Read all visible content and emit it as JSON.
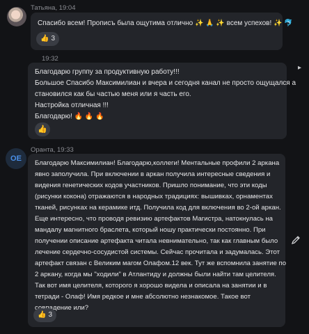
{
  "messages": [
    {
      "author": "Татьяна",
      "time": "19:04",
      "lines": [
        "Спасибо всем! Прописъ была ощутима отлично ✨ 🙏 ✨ всем успехов! ✨ 🐬"
      ],
      "reaction": {
        "emoji": "👍",
        "count": "3"
      }
    },
    {
      "author": "",
      "time": "19:32",
      "lines": [
        "Благодарю группу за продуктивную работу!!!",
        "Большое Спасибо Максимилиан и вчера и сегодня канал не просто ощущался а",
        "становился как бы частью меня или я часть его.",
        "Настройка отличная !!!",
        "Благодарю! 🔥 🔥 🔥"
      ],
      "reaction": {
        "emoji": "👍",
        "count": ""
      }
    },
    {
      "author": "Оранта",
      "time": "19:33",
      "avatar_initials": "OE",
      "lines": [
        "Благодарю Максимилиан! Благодарю,коллеги! Ментальные профили 2 аркана",
        "явно заполучила. При включении в аркан получила интересные сведения и",
        "видения генетических кодов участников. Пришло понимание, что эти коды",
        "(рисунки кокона) отражаются в народных традициях:  вышивках, орнаментах",
        "тканей, рисунках на керамике итд. Получила код для включения во 2-ой аркан.",
        "Еще интересно, что проводя ревизию артефактов Магистра, натокнулась на",
        "мандалу магнитного браслета, который ношу практически постоянно. При",
        "получении описание артефакта читала невнимательно, так как главным было",
        "лечение сердечно-сосудистой системы. Сейчас прочитала и задумалась. Этот",
        "артефакт связан с Великим магом Олафом.12 век.  Тут же вспомнила занятие по",
        "2 аркану, когда мы \"ходили\" в Атлантиду и должны были найти там целителя.",
        "Так вот имя целителя, которого я хорошо видела и описала на занятии и в",
        "тетради - Олаф! Имя редкое и мне абсолютно незнакомое. Такое вот",
        "совпадение или?"
      ],
      "reaction": {
        "emoji": "👍",
        "count": "3"
      }
    }
  ],
  "colors": {
    "background": "#121316",
    "bubble": "#23252a",
    "accent": "#4a8fe7"
  }
}
